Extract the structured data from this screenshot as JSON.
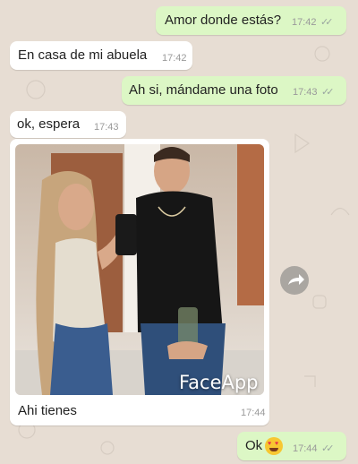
{
  "colors": {
    "background": "#e7ddd3",
    "outgoing_bubble": "#dcf7c5",
    "incoming_bubble": "#ffffff",
    "timestamp": "#9a9a9a"
  },
  "messages": [
    {
      "direction": "outgoing",
      "text": "Amor donde estás?",
      "time": "17:42",
      "status": "double-check-icon"
    },
    {
      "direction": "incoming",
      "text": "En casa de mi abuela",
      "time": "17:42"
    },
    {
      "direction": "outgoing",
      "text": "Ah si, mándame una foto",
      "time": "17:43",
      "status": "double-check-icon"
    },
    {
      "direction": "incoming",
      "text": "ok, espera",
      "time": "17:43"
    },
    {
      "direction": "incoming",
      "type": "image",
      "caption": "Ahi tienes",
      "time": "17:44",
      "watermark": "FaceApp"
    },
    {
      "direction": "outgoing",
      "text": "Ok",
      "emoji": "heart-eyes-emoji",
      "time": "17:44",
      "status": "double-check-icon"
    }
  ],
  "forward_button_icon": "forward-arrow-icon"
}
